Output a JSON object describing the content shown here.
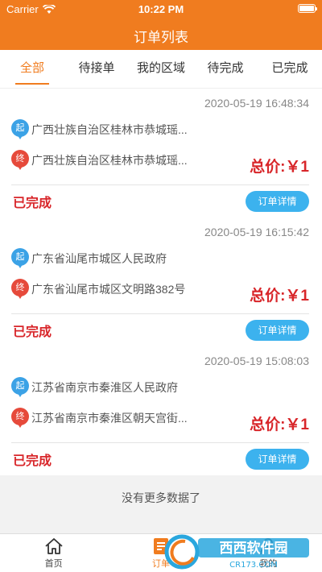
{
  "status_bar": {
    "carrier": "Carrier",
    "time": "10:22 PM"
  },
  "nav": {
    "title": "订单列表"
  },
  "tabs": [
    {
      "label": "全部",
      "active": true
    },
    {
      "label": "待接单",
      "active": false
    },
    {
      "label": "我的区域",
      "active": false
    },
    {
      "label": "待完成",
      "active": false
    },
    {
      "label": "已完成",
      "active": false
    }
  ],
  "orders": [
    {
      "time": "2020-05-19 16:48:34",
      "start_marker": "起",
      "start_address": "广西壮族自治区桂林市恭城瑶...",
      "end_marker": "终",
      "end_address": "广西壮族自治区桂林市恭城瑶...",
      "price": "总价:￥1",
      "status": "已完成",
      "detail_label": "订单详情"
    },
    {
      "time": "2020-05-19 16:15:42",
      "start_marker": "起",
      "start_address": "广东省汕尾市城区人民政府",
      "end_marker": "终",
      "end_address": "广东省汕尾市城区文明路382号",
      "price": "总价:￥1",
      "status": "已完成",
      "detail_label": "订单详情"
    },
    {
      "time": "2020-05-19 15:08:03",
      "start_marker": "起",
      "start_address": "江苏省南京市秦淮区人民政府",
      "end_marker": "终",
      "end_address": "江苏省南京市秦淮区朝天宫街...",
      "price": "总价:￥1",
      "status": "已完成",
      "detail_label": "订单详情"
    }
  ],
  "footer": {
    "no_more": "没有更多数据了"
  },
  "tabbar": [
    {
      "label": "首页",
      "icon": "home-icon"
    },
    {
      "label": "订单",
      "icon": "order-icon"
    },
    {
      "label": "我的",
      "icon": "profile-icon"
    }
  ],
  "watermark": {
    "brand": "西西软件园",
    "url": "CR173.COM"
  },
  "colors": {
    "primary": "#f07c1f",
    "price": "#d8262a",
    "button": "#3cb2ee",
    "start_pin": "#3ba2e6",
    "end_pin": "#e64a3b"
  }
}
